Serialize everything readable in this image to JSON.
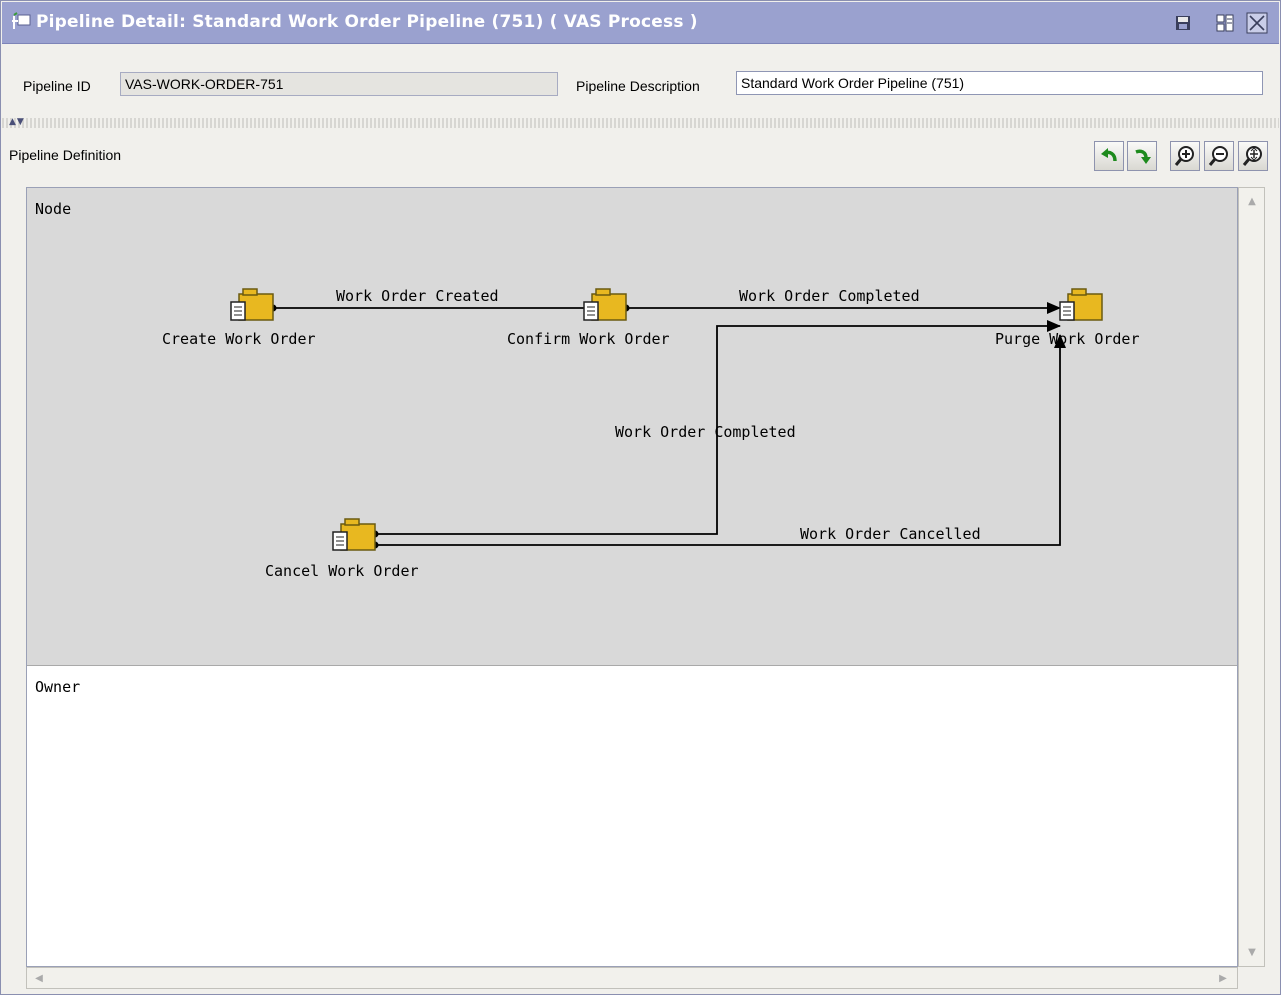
{
  "window": {
    "title": "Pipeline Detail: Standard Work Order Pipeline (751) ( VAS Process )",
    "icons": [
      "pipeline-icon",
      "save-icon",
      "layout-icon",
      "close-icon"
    ]
  },
  "fields": {
    "pipeline_id_label": "Pipeline ID",
    "pipeline_id_value": "VAS-WORK-ORDER-751",
    "pipeline_description_label": "Pipeline Description",
    "pipeline_description_value": "Standard Work Order Pipeline (751)"
  },
  "definition": {
    "header": "Pipeline Definition",
    "toolbar": [
      "undo-icon",
      "redo-icon",
      "zoom-in-icon",
      "zoom-out-icon",
      "zoom-fit-icon"
    ]
  },
  "lanes": {
    "node": "Node",
    "owner": "Owner"
  },
  "nodes": {
    "create": "Create Work Order",
    "confirm": "Confirm Work Order",
    "purge": "Purge Work Order",
    "cancel": "Cancel Work Order"
  },
  "transitions": {
    "created": "Work Order Created",
    "completed_top": "Work Order Completed",
    "completed_mid": "Work Order Completed",
    "cancelled": "Work Order Cancelled"
  },
  "colors": {
    "title_bar": "#9aa1cf",
    "node_lane": "#d9d9d9",
    "owner_lane": "#ffffff",
    "node_icon": "#e8b820"
  }
}
